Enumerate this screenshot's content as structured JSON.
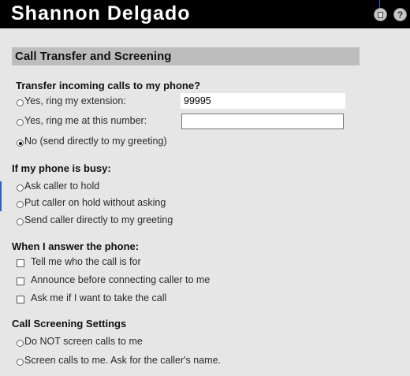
{
  "header": {
    "title": "Shannon Delgado",
    "icons": [
      "save-icon",
      "help-icon"
    ],
    "help_glyph": "?"
  },
  "section": {
    "title": "Call Transfer and Screening"
  },
  "transfer": {
    "question": "Transfer incoming calls to my phone?",
    "option_extension": "Yes, ring my extension:",
    "extension_value": "99995",
    "option_number": "Yes, ring me at this number:",
    "number_value": "",
    "option_greeting": "No (send directly to my greeting)",
    "selected": "greeting"
  },
  "busy": {
    "heading": "If my phone is busy:",
    "options": [
      "Ask caller to hold",
      "Put caller on hold without asking",
      "Send caller directly to my greeting"
    ]
  },
  "answer": {
    "heading": "When I answer the phone:",
    "options": [
      "Tell me who the call is for",
      "Announce before connecting caller to me",
      "Ask me if I want to take the call"
    ]
  },
  "screening": {
    "heading": "Call Screening Settings",
    "options": [
      "Do NOT screen calls to me",
      "Screen calls to me. Ask for the caller's name."
    ]
  }
}
